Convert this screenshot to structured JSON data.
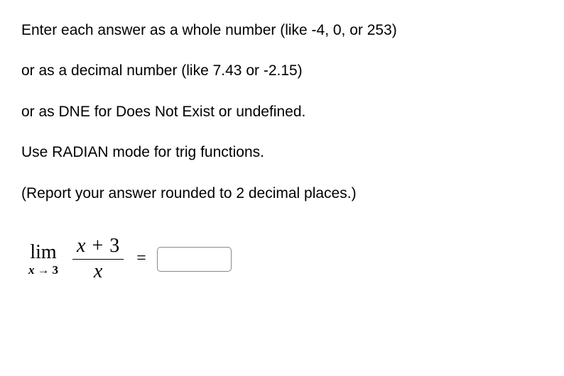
{
  "instructions": {
    "line1": "Enter each answer as a whole number (like -4, 0, or 253)",
    "line2": "or as a decimal number (like 7.43 or -2.15)",
    "line3": "or as DNE for Does Not Exist or undefined.",
    "line4": "Use RADIAN mode for trig functions.",
    "line5": "(Report your answer rounded to 2 decimal places.)"
  },
  "problem": {
    "limit_label": "lim",
    "limit_var": "x",
    "limit_arrow": "→",
    "limit_value": "3",
    "numerator_var": "x",
    "numerator_op": "+",
    "numerator_const": "3",
    "denominator": "x",
    "equals": "=",
    "answer_value": ""
  }
}
